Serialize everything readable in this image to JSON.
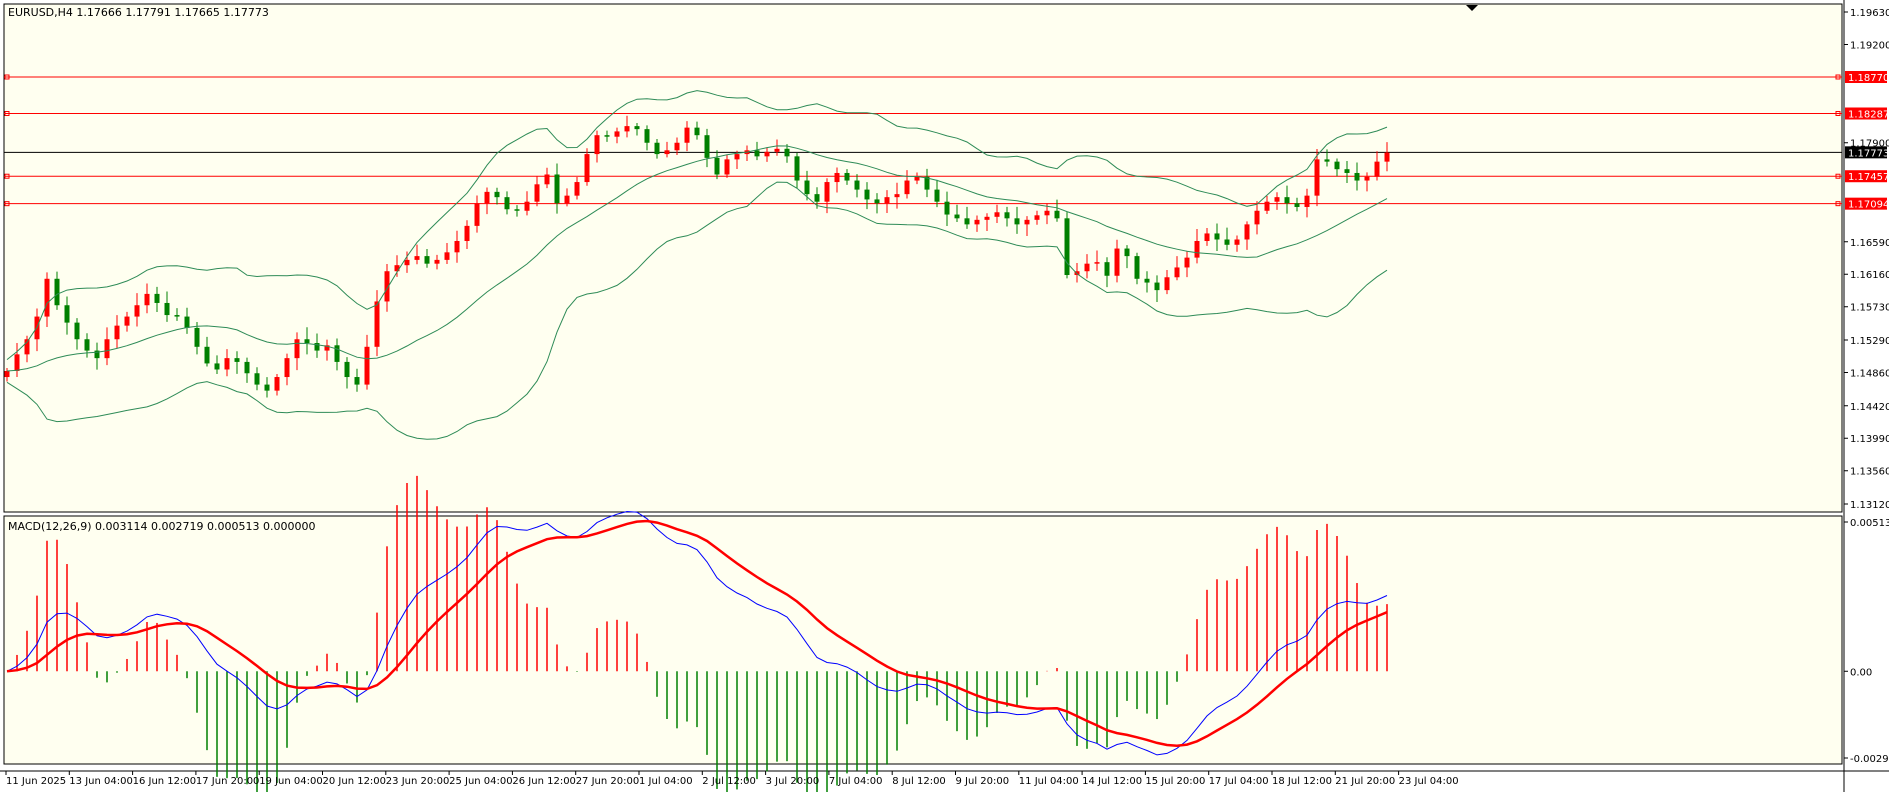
{
  "chart_data": {
    "type": "candlestick",
    "symbol_header": "EURUSD,H4  1.17666 1.17791 1.17665 1.17773",
    "price_axis": {
      "min": 1.1312,
      "max": 1.1963,
      "ticks": [
        "1.19630",
        "1.19200",
        "1.18770",
        "1.18287",
        "1.17900",
        "1.17773",
        "1.17457",
        "1.17094",
        "1.16590",
        "1.16160",
        "1.15730",
        "1.15290",
        "1.14860",
        "1.14420",
        "1.13990",
        "1.13560",
        "1.13120"
      ],
      "tick_values": [
        1.1963,
        1.192,
        1.1877,
        1.18287,
        1.179,
        1.17773,
        1.17457,
        1.17094,
        1.1659,
        1.1616,
        1.1573,
        1.1529,
        1.1486,
        1.1442,
        1.1399,
        1.1356,
        1.1312
      ]
    },
    "horizontal_lines": [
      {
        "value": 1.1877,
        "label": "1.18770",
        "color": "#ff0000"
      },
      {
        "value": 1.18287,
        "label": "1.18287",
        "color": "#ff0000"
      },
      {
        "value": 1.17457,
        "label": "1.17457",
        "color": "#ff0000"
      },
      {
        "value": 1.17094,
        "label": "1.17094",
        "color": "#ff0000"
      }
    ],
    "current_price": {
      "value": 1.17773,
      "label": "1.17773",
      "color": "#000000"
    },
    "time_axis": [
      "11 Jun 2025",
      "13 Jun 04:00",
      "16 Jun 12:00",
      "17 Jun 20:00",
      "19 Jun 04:00",
      "20 Jun 12:00",
      "23 Jun 20:00",
      "25 Jun 04:00",
      "26 Jun 12:00",
      "27 Jun 20:00",
      "1 Jul 04:00",
      "2 Jul 12:00",
      "3 Jul 20:00",
      "7 Jul 04:00",
      "8 Jul 12:00",
      "9 Jul 20:00",
      "11 Jul 04:00",
      "14 Jul 12:00",
      "15 Jul 20:00",
      "17 Jul 04:00",
      "18 Jul 12:00",
      "21 Jul 20:00",
      "23 Jul 04:00"
    ],
    "close_series": [
      1.1488,
      1.151,
      1.153,
      1.156,
      1.161,
      1.1575,
      1.1552,
      1.153,
      1.1515,
      1.1505,
      1.153,
      1.1548,
      1.156,
      1.1575,
      1.159,
      1.1578,
      1.1562,
      1.156,
      1.1545,
      1.152,
      1.1498,
      1.149,
      1.1505,
      1.15,
      1.1485,
      1.147,
      1.1462,
      1.148,
      1.1505,
      1.153,
      1.1525,
      1.1515,
      1.1522,
      1.15,
      1.148,
      1.147,
      1.152,
      1.158,
      1.162,
      1.1628,
      1.1635,
      1.164,
      1.163,
      1.1635,
      1.1645,
      1.166,
      1.168,
      1.171,
      1.1725,
      1.1718,
      1.1702,
      1.17,
      1.1712,
      1.1735,
      1.1748,
      1.171,
      1.172,
      1.1738,
      1.1775,
      1.18,
      1.1798,
      1.1805,
      1.1812,
      1.1808,
      1.179,
      1.1775,
      1.178,
      1.179,
      1.181,
      1.18,
      1.177,
      1.1748,
      1.1768,
      1.1775,
      1.178,
      1.1772,
      1.1778,
      1.1782,
      1.1772,
      1.174,
      1.1722,
      1.1712,
      1.1738,
      1.175,
      1.174,
      1.1728,
      1.1715,
      1.171,
      1.1718,
      1.1722,
      1.174,
      1.1745,
      1.1728,
      1.1712,
      1.1695,
      1.169,
      1.1682,
      1.1688,
      1.1692,
      1.1698,
      1.169,
      1.1682,
      1.1688,
      1.1694,
      1.17,
      1.169,
      1.1615,
      1.162,
      1.163,
      1.1632,
      1.1614,
      1.165,
      1.164,
      1.161,
      1.1605,
      1.1595,
      1.1612,
      1.1625,
      1.1638,
      1.166,
      1.167,
      1.1662,
      1.1655,
      1.1662,
      1.1682,
      1.17,
      1.1712,
      1.1718,
      1.171,
      1.1705,
      1.172,
      1.1768,
      1.1765,
      1.1755,
      1.175,
      1.174,
      1.1745,
      1.1765,
      1.1777
    ],
    "bands": {
      "color": "#2e8b57",
      "width": 1
    },
    "up_color": "#ff0000",
    "down_color": "#008000"
  },
  "macd": {
    "header": "MACD(12,26,9) 0.003114 0.002719 0.000513 0.000000",
    "axis_min": -0.002985,
    "axis_max": 0.005137,
    "ticks": [
      "0.005137",
      "0.00",
      "-0.002985"
    ],
    "tick_values": [
      0.005137,
      0.0,
      -0.002985
    ],
    "macd_line_color": "#0000ff",
    "signal_line_color": "#ff0000",
    "hist_pos_color": "#ff0000",
    "hist_neg_color": "#008000"
  },
  "colors": {
    "chart_bg": "#fffff0",
    "frame": "#000000",
    "axis_bg": "#ffffff"
  }
}
